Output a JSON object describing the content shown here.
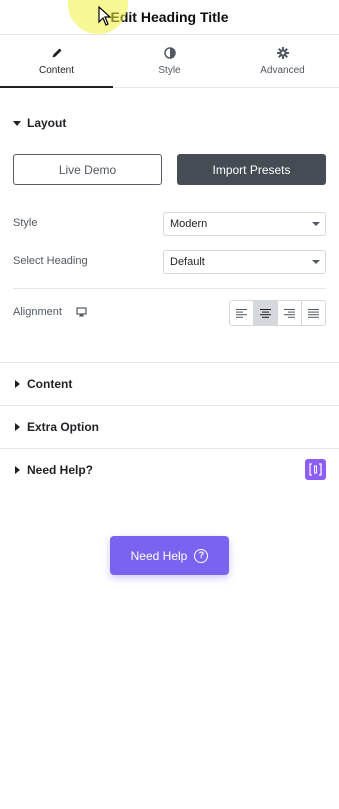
{
  "header": {
    "title": "Edit Heading Title"
  },
  "tabs": [
    {
      "label": "Content",
      "icon": "pencil-icon",
      "active": true
    },
    {
      "label": "Style",
      "icon": "half-circle-icon",
      "active": false
    },
    {
      "label": "Advanced",
      "icon": "gear-icon",
      "active": false
    }
  ],
  "layout": {
    "title": "Layout",
    "live_demo_label": "Live Demo",
    "import_presets_label": "Import Presets",
    "style": {
      "label": "Style",
      "value": "Modern"
    },
    "select_heading": {
      "label": "Select Heading",
      "value": "Default"
    },
    "alignment": {
      "label": "Alignment",
      "selected": "center",
      "options": [
        "left",
        "center",
        "right",
        "justify"
      ]
    }
  },
  "sections": [
    {
      "title": "Content"
    },
    {
      "title": "Extra Option"
    },
    {
      "title": "Need Help?"
    }
  ],
  "help_button": {
    "label": "Need Help",
    "icon": "question-icon"
  },
  "colors": {
    "accent": "#7a63f0",
    "dark_button": "#454c54",
    "help_icon_bg": "#8c5ef5"
  }
}
